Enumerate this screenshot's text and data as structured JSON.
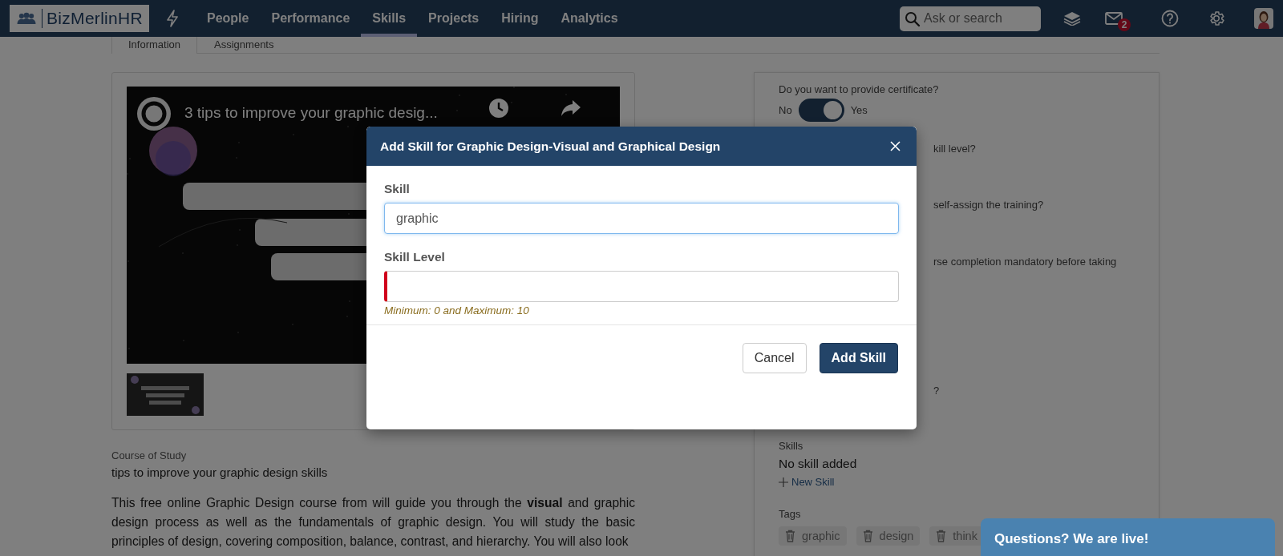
{
  "nav": {
    "logo": "BizMerlinHR",
    "items": [
      {
        "label": "People",
        "selected": false
      },
      {
        "label": "Performance",
        "selected": false
      },
      {
        "label": "Skills",
        "selected": true
      },
      {
        "label": "Projects",
        "selected": false
      },
      {
        "label": "Hiring",
        "selected": false
      },
      {
        "label": "Analytics",
        "selected": false
      }
    ],
    "search": {
      "placeholder": "Ask or search"
    },
    "mail_badge": "2"
  },
  "tabs": [
    {
      "label": "Information",
      "selected": true
    },
    {
      "label": "Assignments",
      "selected": false
    }
  ],
  "video": {
    "title": "3 tips to improve your graphic desig..."
  },
  "course": {
    "label": "Course of Study",
    "value": "tips to improve your graphic design skills",
    "description": "This free online Graphic Design course from will guide you through the **visual** and graphic design process as well as the fundamentals of graphic design. You will study the basic principles of design, covering composition, balance, contrast, and hierarchy. You will also look"
  },
  "settings": {
    "certificate": {
      "question": "Do you want to provide certificate?",
      "off_label": "No",
      "on_label": "Yes",
      "on": true
    },
    "partial_texts": [
      "kill level?",
      "self-assign the training?",
      "rse completion mandatory before taking",
      "?"
    ],
    "skills": {
      "label": "Skills",
      "empty": "No skill added",
      "add": "New Skill"
    },
    "tags": {
      "label": "Tags",
      "items": [
        "graphic",
        "design",
        "think"
      ]
    }
  },
  "dialog": {
    "title": "Add Skill for Graphic Design-Visual and Graphical Design",
    "fields": [
      {
        "label": "Skill",
        "value": "graphic",
        "invalid": false,
        "focused": true
      },
      {
        "label": "Skill Level",
        "invalid": true,
        "focused": false,
        "hint": "Minimum: 0 and Maximum: 10"
      }
    ],
    "buttons": [
      {
        "label": "Cancel",
        "kind": "secondary"
      },
      {
        "label": "Add Skill",
        "kind": "primary"
      }
    ]
  },
  "chat": {
    "label": "Questions? We are live!"
  }
}
